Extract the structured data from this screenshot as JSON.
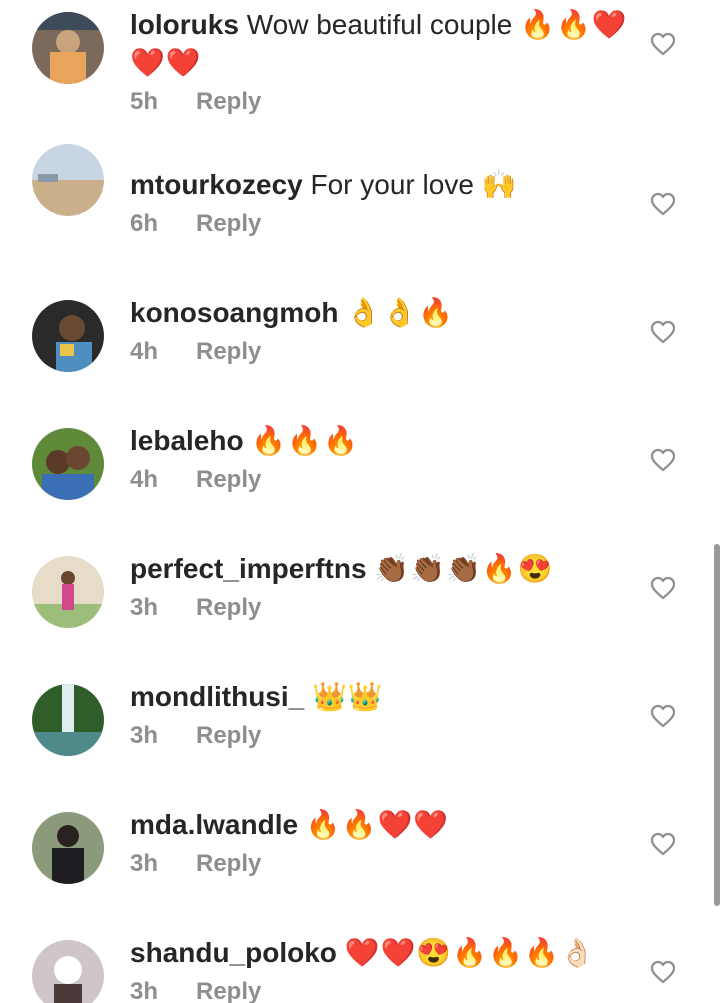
{
  "comments": [
    {
      "username": "loloruks",
      "text": "Wow beautiful couple",
      "emojis": "🔥🔥❤️❤️❤️",
      "time": "5h",
      "reply": "Reply"
    },
    {
      "username": "mtourkozecy",
      "text": "For your love",
      "emojis": "🙌",
      "time": "6h",
      "reply": "Reply"
    },
    {
      "username": "konosoangmoh",
      "text": "",
      "emojis": "👌👌🔥",
      "time": "4h",
      "reply": "Reply"
    },
    {
      "username": "lebaleho",
      "text": "",
      "emojis": "🔥🔥🔥",
      "time": "4h",
      "reply": "Reply"
    },
    {
      "username": "perfect_imperftns",
      "text": "",
      "emojis": "👏🏾👏🏾👏🏾🔥😍",
      "time": "3h",
      "reply": "Reply"
    },
    {
      "username": "mondlithusi_",
      "text": "",
      "emojis": "👑👑",
      "time": "3h",
      "reply": "Reply"
    },
    {
      "username": "mda.lwandle",
      "text": "",
      "emojis": "🔥🔥❤️❤️",
      "time": "3h",
      "reply": "Reply"
    },
    {
      "username": "shandu_poloko",
      "text": "",
      "emojis": "❤️❤️😍🔥🔥🔥👌🏻",
      "time": "3h",
      "reply": "Reply"
    }
  ],
  "icons": {
    "like": "heart-outline-icon"
  },
  "colors": {
    "text": "#262626",
    "secondary": "#8e8e8e",
    "heart_stroke": "#8e8e8e"
  }
}
